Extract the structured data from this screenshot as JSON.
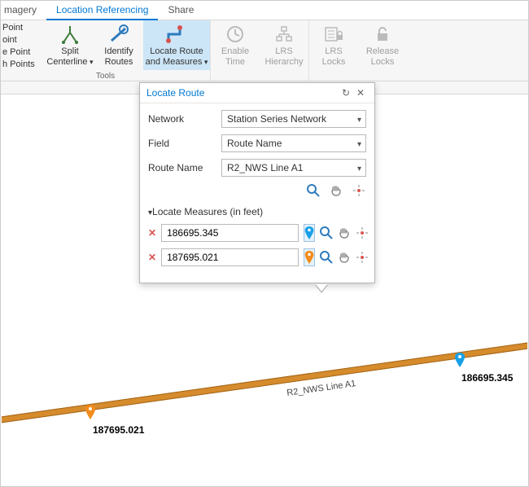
{
  "tabs": {
    "imagery": "magery",
    "location_ref": "Location Referencing",
    "share": "Share"
  },
  "ribbon": {
    "small": {
      "pt1": "Point",
      "pt2": "oint",
      "pt3": "e Point",
      "pt4": "h Points"
    },
    "split": "Split\nCenterline",
    "identify": "Identify\nRoutes",
    "locate": "Locate Route\nand Measures",
    "enable": "Enable\nTime",
    "hierarchy": "LRS\nHierarchy",
    "locks": "LRS\nLocks",
    "release": "Release\nLocks",
    "group_label": "Tools"
  },
  "panel": {
    "title": "Locate Route",
    "network_label": "Network",
    "network_value": "Station Series Network",
    "field_label": "Field",
    "field_value": "Route Name",
    "route_label": "Route Name",
    "route_value": "R2_NWS Line A1",
    "section": "Locate Measures (in feet)",
    "m1": "186695.345",
    "m2": "187695.021"
  },
  "map": {
    "route_text": "R2_NWS Line A1",
    "label1": "186695.345",
    "label2": "187695.021"
  }
}
